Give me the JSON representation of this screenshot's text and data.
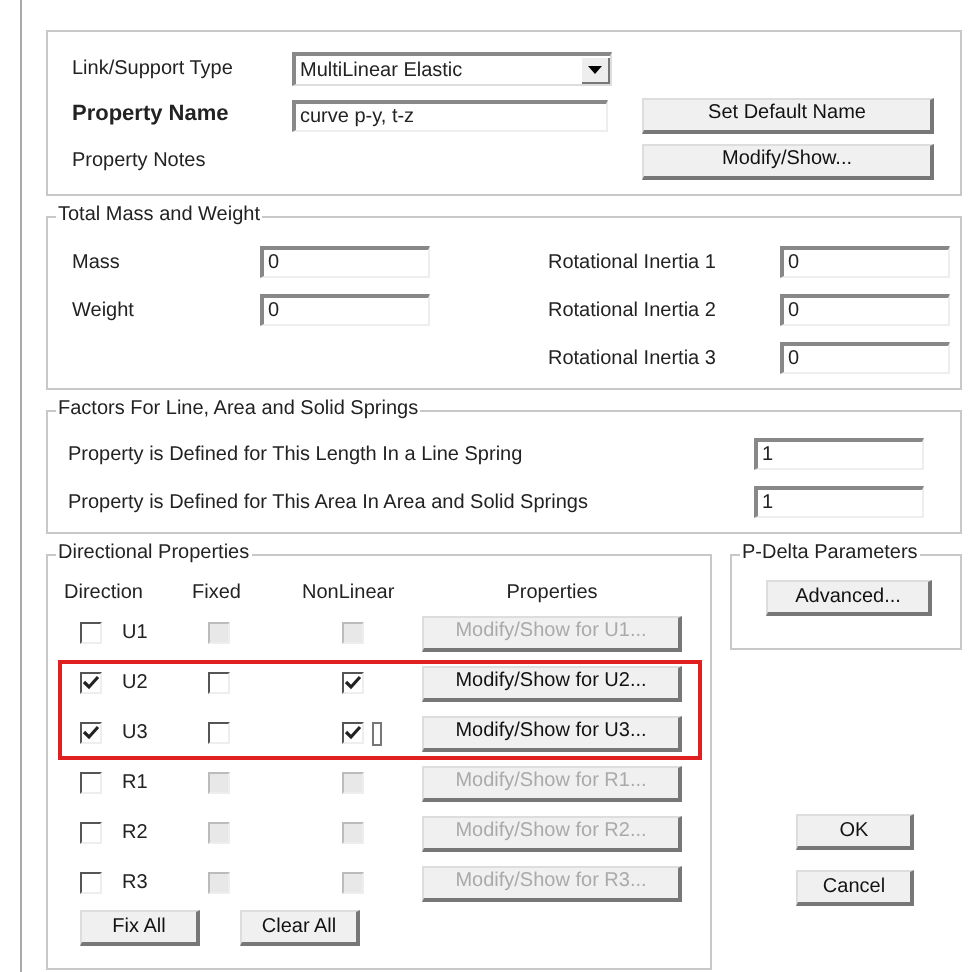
{
  "property": {
    "type_label": "Link/Support Type",
    "type_value": "MultiLinear Elastic",
    "name_label": "Property Name",
    "name_value": "curve p-y, t-z",
    "default_button": "Set Default Name",
    "notes_label": "Property Notes",
    "notes_button": "Modify/Show..."
  },
  "mass": {
    "title": "Total Mass and Weight",
    "fields": [
      {
        "label": "Mass",
        "value": "0"
      },
      {
        "label": "Weight",
        "value": "0"
      }
    ],
    "inertia": [
      {
        "label": "Rotational Inertia 1",
        "value": "0"
      },
      {
        "label": "Rotational Inertia 2",
        "value": "0"
      },
      {
        "label": "Rotational Inertia 3",
        "value": "0"
      }
    ]
  },
  "factors": {
    "title": "Factors For Line, Area and Solid Springs",
    "rows": [
      {
        "label": "Property is Defined for This Length In a Line Spring",
        "value": "1"
      },
      {
        "label": "Property is Defined for This Area In Area and Solid Springs",
        "value": "1"
      }
    ]
  },
  "directional": {
    "title": "Directional Properties",
    "columns": [
      "Direction",
      "Fixed",
      "NonLinear",
      "Properties"
    ],
    "rows": [
      {
        "label": "U1",
        "checked": false,
        "fixed": false,
        "nonlinear": false,
        "disabled": true,
        "button": "Modify/Show for U1...",
        "focus": false
      },
      {
        "label": "U2",
        "checked": true,
        "fixed": false,
        "nonlinear": true,
        "disabled": false,
        "button": "Modify/Show for U2...",
        "focus": false
      },
      {
        "label": "U3",
        "checked": true,
        "fixed": false,
        "nonlinear": true,
        "disabled": false,
        "button": "Modify/Show for U3...",
        "focus": true
      },
      {
        "label": "R1",
        "checked": false,
        "fixed": false,
        "nonlinear": false,
        "disabled": true,
        "button": "Modify/Show for R1...",
        "focus": false
      },
      {
        "label": "R2",
        "checked": false,
        "fixed": false,
        "nonlinear": false,
        "disabled": true,
        "button": "Modify/Show for R2...",
        "focus": false
      },
      {
        "label": "R3",
        "checked": false,
        "fixed": false,
        "nonlinear": false,
        "disabled": true,
        "button": "Modify/Show for R3...",
        "focus": false
      }
    ],
    "fix_all": "Fix All",
    "clear_all": "Clear All"
  },
  "pdelta": {
    "title": "P-Delta Parameters",
    "button": "Advanced..."
  },
  "buttons": [
    "OK",
    "Cancel"
  ]
}
